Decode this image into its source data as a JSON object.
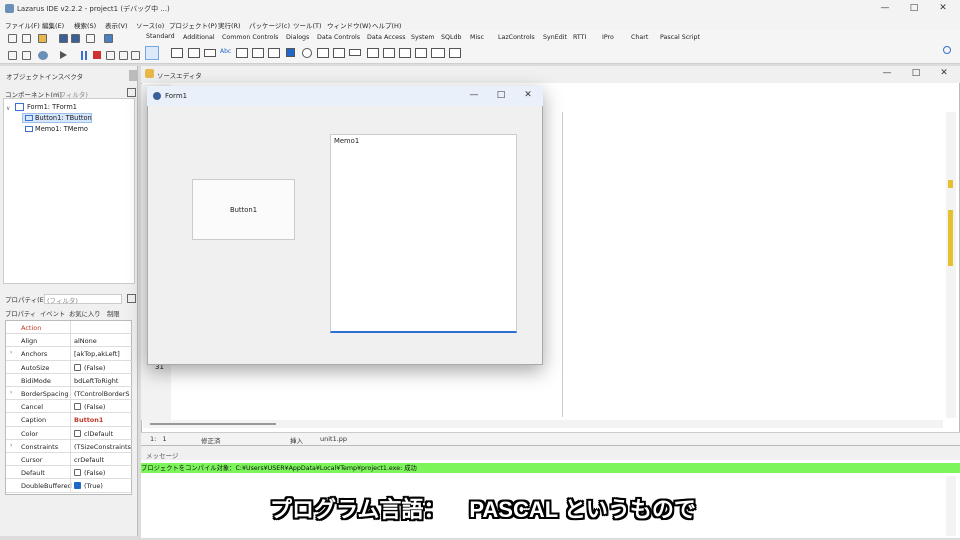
{
  "window": {
    "title": "Lazarus IDE v2.2.2 - project1 (デバッグ中 ...)"
  },
  "menu": [
    "ファイル(F)",
    "編集(E)",
    "検索(S)",
    "表示(V)",
    "ソース(o)",
    "プロジェクト(P)",
    "実行(R)",
    "パッケージ(c)",
    "ツール(T)",
    "ウィンドウ(W)",
    "ヘルプ(H)"
  ],
  "palette_tabs": [
    "Standard",
    "Additional",
    "Common Controls",
    "Dialogs",
    "Data Controls",
    "Data Access",
    "System",
    "SQLdb",
    "Misc",
    "LazControls",
    "SynEdit",
    "RTTI",
    "IPro",
    "Chart",
    "Pascal Script"
  ],
  "object_inspector": {
    "title": "オブジェクトインスペクタ",
    "component_label": "コンポーネント(m)",
    "filter_placeholder": "(フィルタ)",
    "tree": [
      "Form1: TForm1",
      "Button1: TButton",
      "Memo1: TMemo"
    ],
    "property_label": "プロパティ(E)",
    "tabs": [
      "プロパティ",
      "イベント",
      "お気に入り",
      "制限"
    ],
    "properties": [
      {
        "name": "Action",
        "value": ""
      },
      {
        "name": "Align",
        "value": "alNone"
      },
      {
        "name": "Anchors",
        "value": "[akTop,akLeft]"
      },
      {
        "name": "AutoSize",
        "value": "(False)"
      },
      {
        "name": "BidiMode",
        "value": "bdLeftToRight"
      },
      {
        "name": "BorderSpacing",
        "value": "(TControlBorderS"
      },
      {
        "name": "Cancel",
        "value": "(False)"
      },
      {
        "name": "Caption",
        "value": "Button1"
      },
      {
        "name": "Color",
        "value": "clDefault"
      },
      {
        "name": "Constraints",
        "value": "(TSizeConstraints"
      },
      {
        "name": "Cursor",
        "value": "crDefault"
      },
      {
        "name": "Default",
        "value": "(False)"
      },
      {
        "name": "DoubleBuffered",
        "value": "(True)"
      }
    ]
  },
  "source_editor": {
    "title": "ソースエディタ",
    "line_number": "31",
    "status": {
      "pos": "1:   1",
      "modified": "修正済",
      "mode": "挿入",
      "file": "unit1.pp"
    }
  },
  "messages": {
    "title": "メッセージ",
    "line": "プロジェクトをコンパイル対象：C:¥Users¥USER¥AppData¥Local¥Temp¥project1.exe: 成功"
  },
  "form1": {
    "title": "Form1",
    "button_caption": "Button1",
    "memo_text": "Memo1"
  },
  "caption": {
    "part1": "プログラム言語：",
    "part2": "PASCAL というもので"
  },
  "colors": {
    "message_ok": "#7cf55a",
    "action_red": "#c0392b"
  }
}
